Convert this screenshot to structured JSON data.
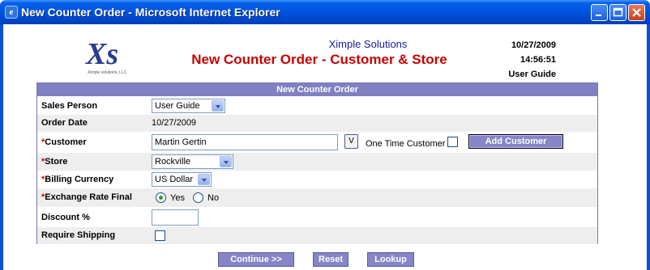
{
  "window": {
    "title": "New Counter Order - Microsoft Internet Explorer",
    "app_icon": "ie-icon",
    "buttons": [
      "minimize-icon",
      "maximize-icon",
      "close-icon"
    ]
  },
  "header": {
    "company": "Ximple Solutions",
    "title": "New Counter Order - Customer & Store",
    "date": "10/27/2009",
    "time": "14:56:51",
    "user": "User Guide",
    "logo_text": "Xs",
    "logo_subtext": "Ximple solutions, LLC"
  },
  "form": {
    "heading": "New Counter Order",
    "sales_person": {
      "label": "Sales Person",
      "value": "User Guide"
    },
    "order_date": {
      "label": "Order Date",
      "value": "10/27/2009"
    },
    "customer": {
      "required": "*",
      "label": "Customer",
      "value": "Martin Gertin",
      "lookup_label": "V"
    },
    "one_time_customer": {
      "label": "One Time Customer",
      "checked": false
    },
    "add_customer_label": "Add Customer",
    "store": {
      "required": "*",
      "label": "Store",
      "value": "Rockville"
    },
    "billing_currency": {
      "required": "*",
      "label": "Billing Currency",
      "value": "US Dollar"
    },
    "exchange_rate_final": {
      "required": "*",
      "label": "Exchange Rate Final",
      "yes_label": "Yes",
      "no_label": "No",
      "selected": "Yes"
    },
    "discount": {
      "label": "Discount %",
      "value": ""
    },
    "require_shipping": {
      "label": "Require Shipping",
      "checked": false
    }
  },
  "actions": {
    "continue_label": "Continue >>",
    "reset_label": "Reset",
    "lookup_label": "Lookup"
  },
  "colors": {
    "titlebar": "#0054e3",
    "heading_red": "#c80000",
    "company_blue": "#1b1b9e",
    "form_header": "#8080c2",
    "button_purple": "#8585c8"
  }
}
